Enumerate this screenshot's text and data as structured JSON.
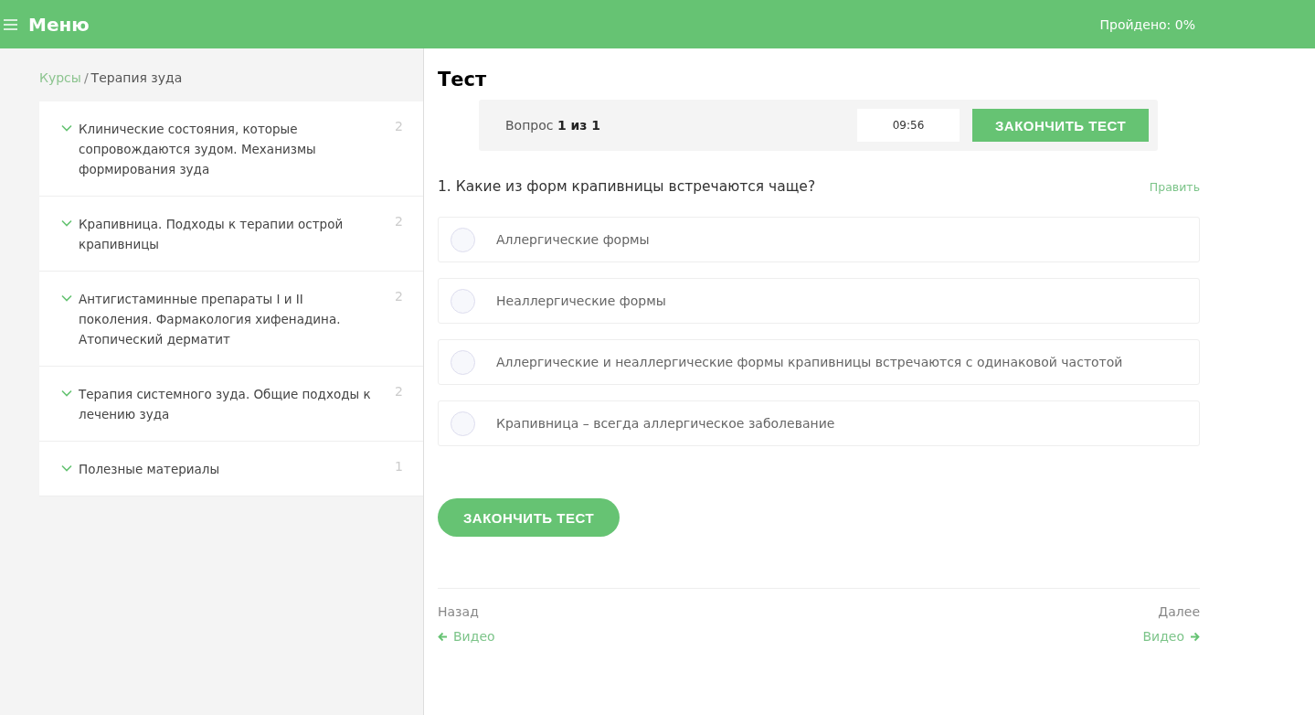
{
  "header": {
    "menu_label": "Меню",
    "progress": "Пройдено: 0%"
  },
  "breadcrumb": {
    "link": "Курсы",
    "separator": "/",
    "current": "Терапия зуда"
  },
  "sidebar": {
    "items": [
      {
        "title": "Клинические состояния, которые сопровождаются зудом. Механизмы формирования зуда",
        "count": "2"
      },
      {
        "title": "Крапивница. Подходы к терапии острой крапивницы",
        "count": "2"
      },
      {
        "title": "Антигистаминные препараты I и II поколения. Фармакология хифенадина. Атопический дерматит",
        "count": "2"
      },
      {
        "title": "Терапия системного зуда. Общие подходы к лечению зуда",
        "count": "2"
      },
      {
        "title": "Полезные материалы",
        "count": "1"
      }
    ]
  },
  "test": {
    "title": "Тест",
    "question_counter": "Вопрос **1 из 1**",
    "timer": "09:56",
    "finish_button": "ЗАКОНЧИТЬ ТЕСТ",
    "question": "1. Какие из форм крапивницы встречаются чаще?",
    "edit_link": "Править",
    "options": [
      {
        "label": "Аллергические формы",
        "selected": false
      },
      {
        "label": "Неаллергические формы",
        "selected": false
      },
      {
        "label": "Аллергические и неаллергические формы крапивницы встречаются с одинаковой частотой",
        "selected": false
      },
      {
        "label": "Крапивница – всегда аллергическое заболевание",
        "selected": false
      }
    ],
    "bottom_button": "ЗАКОНЧИТЬ ТЕСТ"
  },
  "navigation": {
    "prev_label": "Назад",
    "prev_link": "Видео",
    "next_label": "Далее",
    "next_link": "Видео"
  }
}
